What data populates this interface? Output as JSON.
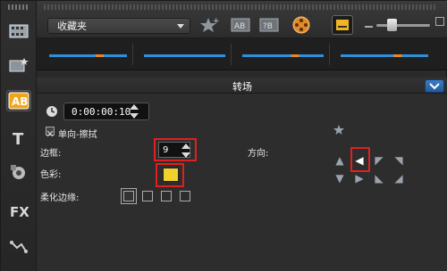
{
  "toolbar": {
    "dropdown_value": "收藏夹"
  },
  "section": {
    "title": "转场"
  },
  "panel": {
    "duration": "0:00:00:10",
    "wipe_label": "单向-擦拭",
    "border_label": "边框:",
    "border_value": "9",
    "color_label": "色彩:",
    "color_value": "#f1d12c",
    "soften_label": "柔化边缘:",
    "direction_label": "方向:"
  },
  "colors": {
    "accent_blue": "#2f8fd9",
    "accent_orange": "#e7862a",
    "highlight_red": "#e02020"
  }
}
